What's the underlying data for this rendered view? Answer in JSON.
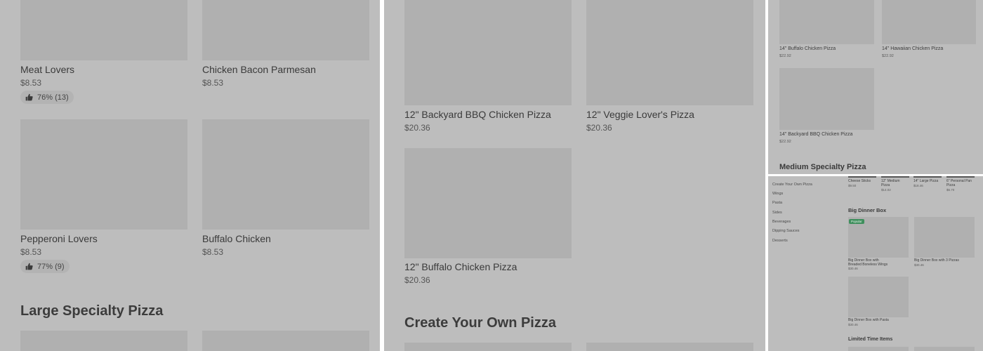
{
  "panel1": {
    "items": [
      {
        "name": "Meat Lovers",
        "price": "$8.53",
        "rating": "76% (13)"
      },
      {
        "name": "Chicken Bacon Parmesan",
        "price": "$8.53"
      },
      {
        "name": "Pepperoni Lovers",
        "price": "$8.53",
        "rating": "77% (9)"
      },
      {
        "name": "Buffalo Chicken",
        "price": "$8.53"
      }
    ],
    "section_heading": "Large Specialty Pizza"
  },
  "panel2": {
    "items": [
      {
        "name": "12\" Backyard BBQ Chicken Pizza",
        "price": "$20.36"
      },
      {
        "name": "12\" Veggie Lover's Pizza",
        "price": "$20.36"
      },
      {
        "name": "12\" Buffalo Chicken Pizza",
        "price": "$20.36"
      }
    ],
    "section_heading": "Create Your Own Pizza"
  },
  "panel3": {
    "items": [
      {
        "name": "14\" Buffalo Chicken Pizza",
        "price": "$22.92"
      },
      {
        "name": "14\" Hawaiian Chicken Pizza",
        "price": "$22.92"
      },
      {
        "name": "14\" Backyard BBQ Chicken Pizza",
        "price": "$22.92"
      }
    ],
    "section_heading": "Medium Specialty Pizza"
  },
  "panel4": {
    "sidebar": [
      "Create Your Own Pizza",
      "Wings",
      "Pasta",
      "Sides",
      "Beverages",
      "Dipping Sauces",
      "Desserts"
    ],
    "top_items": [
      {
        "name": "Cheese Sticks",
        "price": "$9.50"
      },
      {
        "name": "12\" Medium Pizza",
        "price": "$14.02"
      },
      {
        "name": "14\" Large Pizza",
        "price": "$18.46"
      },
      {
        "name": "6\" Personal Pan Pizza",
        "price": "$6.70"
      }
    ],
    "section_heading": "Big Dinner Box",
    "badge": "Popular",
    "items": [
      {
        "name": "Big Dinner Box with Breaded Boneless Wings",
        "price": "$30.46"
      },
      {
        "name": "Big Dinner Box with 3 Pizzas",
        "price": "$30.46"
      },
      {
        "name": "Big Dinner Box with Pasta",
        "price": "$30.46"
      }
    ],
    "next_heading": "Limited Time Items"
  },
  "icons": {
    "rating": "thumbs-up-icon"
  }
}
